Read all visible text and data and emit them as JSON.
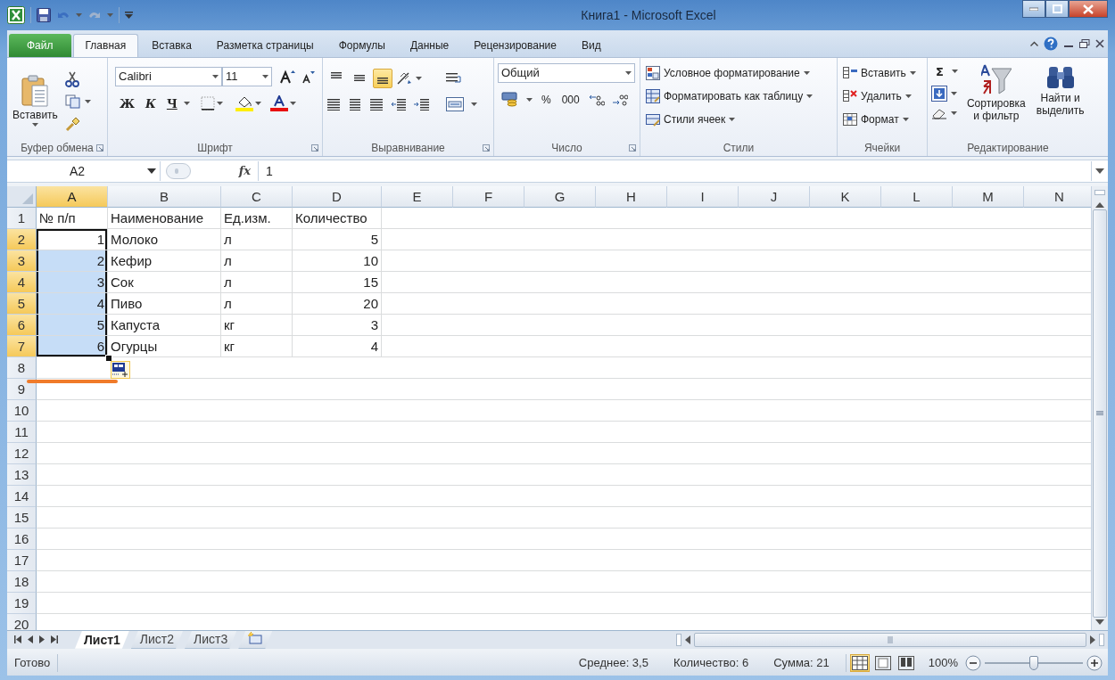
{
  "window": {
    "title": "Книга1 - Microsoft Excel"
  },
  "ribbon_tabs": [
    {
      "label": "Файл",
      "kind": "file",
      "selected": false
    },
    {
      "label": "Главная",
      "kind": "tab",
      "selected": true
    },
    {
      "label": "Вставка",
      "kind": "tab",
      "selected": false
    },
    {
      "label": "Разметка страницы",
      "kind": "tab",
      "selected": false
    },
    {
      "label": "Формулы",
      "kind": "tab",
      "selected": false
    },
    {
      "label": "Данные",
      "kind": "tab",
      "selected": false
    },
    {
      "label": "Рецензирование",
      "kind": "tab",
      "selected": false
    },
    {
      "label": "Вид",
      "kind": "tab",
      "selected": false
    }
  ],
  "ribbon": {
    "clipboard": {
      "label": "Буфер обмена",
      "paste": "Вставить"
    },
    "font": {
      "label": "Шрифт",
      "font_name": "Calibri",
      "font_size": "11",
      "bold": "Ж",
      "italic": "К",
      "underline": "Ч"
    },
    "alignment": {
      "label": "Выравнивание",
      "vertical": [
        {
          "kind": "top",
          "selected": false
        },
        {
          "kind": "middle",
          "selected": false
        },
        {
          "kind": "bottom",
          "selected": true
        }
      ]
    },
    "number": {
      "label": "Число",
      "format": "Общий",
      "percent": "%",
      "thousands": "000"
    },
    "styles": {
      "label": "Стили",
      "items": [
        "Условное форматирование",
        "Форматировать как таблицу",
        "Стили ячеек"
      ]
    },
    "cells": {
      "label": "Ячейки",
      "items": [
        "Вставить",
        "Удалить",
        "Формат"
      ]
    },
    "editing": {
      "label": "Редактирование",
      "autosum": "Σ",
      "sort": [
        "Сортировка",
        "и фильтр"
      ],
      "find": [
        "Найти и",
        "выделить"
      ]
    }
  },
  "formula_bar": {
    "name_box": "A2",
    "function_label": "fx",
    "value": "1"
  },
  "sheet": {
    "columns": [
      {
        "label": "A",
        "selected": true
      },
      {
        "label": "B",
        "selected": false
      },
      {
        "label": "C",
        "selected": false
      },
      {
        "label": "D",
        "selected": false
      },
      {
        "label": "E",
        "selected": false
      },
      {
        "label": "F",
        "selected": false
      },
      {
        "label": "G",
        "selected": false
      },
      {
        "label": "H",
        "selected": false
      },
      {
        "label": "I",
        "selected": false
      },
      {
        "label": "J",
        "selected": false
      },
      {
        "label": "K",
        "selected": false
      },
      {
        "label": "L",
        "selected": false
      },
      {
        "label": "M",
        "selected": false
      },
      {
        "label": "N",
        "selected": false
      }
    ],
    "rows": [
      {
        "label": "1",
        "selected": false,
        "cells": [
          {
            "text": "№ п/п",
            "kind": "text",
            "selected": false,
            "active": false
          },
          {
            "text": "Наименование",
            "kind": "text",
            "selected": false,
            "active": false
          },
          {
            "text": "Ед.изм.",
            "kind": "text",
            "selected": false,
            "active": false
          },
          {
            "text": "Количество",
            "kind": "text",
            "selected": false,
            "active": false
          }
        ]
      },
      {
        "label": "2",
        "selected": true,
        "cells": [
          {
            "text": "1",
            "kind": "number",
            "selected": true,
            "active": true
          },
          {
            "text": "Молоко",
            "kind": "text",
            "selected": false,
            "active": false
          },
          {
            "text": "л",
            "kind": "text",
            "selected": false,
            "active": false
          },
          {
            "text": "5",
            "kind": "number",
            "selected": false,
            "active": false
          }
        ]
      },
      {
        "label": "3",
        "selected": true,
        "cells": [
          {
            "text": "2",
            "kind": "number",
            "selected": true,
            "active": false
          },
          {
            "text": "Кефир",
            "kind": "text",
            "selected": false,
            "active": false
          },
          {
            "text": "л",
            "kind": "text",
            "selected": false,
            "active": false
          },
          {
            "text": "10",
            "kind": "number",
            "selected": false,
            "active": false
          }
        ]
      },
      {
        "label": "4",
        "selected": true,
        "cells": [
          {
            "text": "3",
            "kind": "number",
            "selected": true,
            "active": false
          },
          {
            "text": "Сок",
            "kind": "text",
            "selected": false,
            "active": false
          },
          {
            "text": "л",
            "kind": "text",
            "selected": false,
            "active": false
          },
          {
            "text": "15",
            "kind": "number",
            "selected": false,
            "active": false
          }
        ]
      },
      {
        "label": "5",
        "selected": true,
        "cells": [
          {
            "text": "4",
            "kind": "number",
            "selected": true,
            "active": false
          },
          {
            "text": "Пиво",
            "kind": "text",
            "selected": false,
            "active": false
          },
          {
            "text": "л",
            "kind": "text",
            "selected": false,
            "active": false
          },
          {
            "text": "20",
            "kind": "number",
            "selected": false,
            "active": false
          }
        ]
      },
      {
        "label": "6",
        "selected": true,
        "cells": [
          {
            "text": "5",
            "kind": "number",
            "selected": true,
            "active": false
          },
          {
            "text": "Капуста",
            "kind": "text",
            "selected": false,
            "active": false
          },
          {
            "text": "кг",
            "kind": "text",
            "selected": false,
            "active": false
          },
          {
            "text": "3",
            "kind": "number",
            "selected": false,
            "active": false
          }
        ]
      },
      {
        "label": "7",
        "selected": true,
        "cells": [
          {
            "text": "6",
            "kind": "number",
            "selected": true,
            "active": false
          },
          {
            "text": "Огурцы",
            "kind": "text",
            "selected": false,
            "active": false
          },
          {
            "text": "кг",
            "kind": "text",
            "selected": false,
            "active": false
          },
          {
            "text": "4",
            "kind": "number",
            "selected": false,
            "active": false
          }
        ]
      },
      {
        "label": "8",
        "selected": false
      },
      {
        "label": "9",
        "selected": false
      },
      {
        "label": "10",
        "selected": false
      },
      {
        "label": "11",
        "selected": false
      },
      {
        "label": "12",
        "selected": false
      },
      {
        "label": "13",
        "selected": false
      },
      {
        "label": "14",
        "selected": false
      },
      {
        "label": "15",
        "selected": false
      },
      {
        "label": "16",
        "selected": false
      },
      {
        "label": "17",
        "selected": false
      },
      {
        "label": "18",
        "selected": false
      },
      {
        "label": "19",
        "selected": false
      },
      {
        "label": "20",
        "selected": false
      }
    ],
    "annotation": {
      "kind": "underline"
    }
  },
  "sheet_tabs": [
    {
      "label": "Лист1",
      "selected": true
    },
    {
      "label": "Лист2",
      "selected": false
    },
    {
      "label": "Лист3",
      "selected": false
    }
  ],
  "status_bar": {
    "mode": "Готово",
    "average": "Среднее: 3,5",
    "count": "Количество: 6",
    "sum": "Сумма: 21",
    "views": [
      {
        "kind": "normal",
        "selected": true
      },
      {
        "kind": "page_layout",
        "selected": false
      },
      {
        "kind": "page_break",
        "selected": false
      }
    ],
    "zoom": "100%",
    "zoom_slider": {
      "level": 0.5
    }
  }
}
